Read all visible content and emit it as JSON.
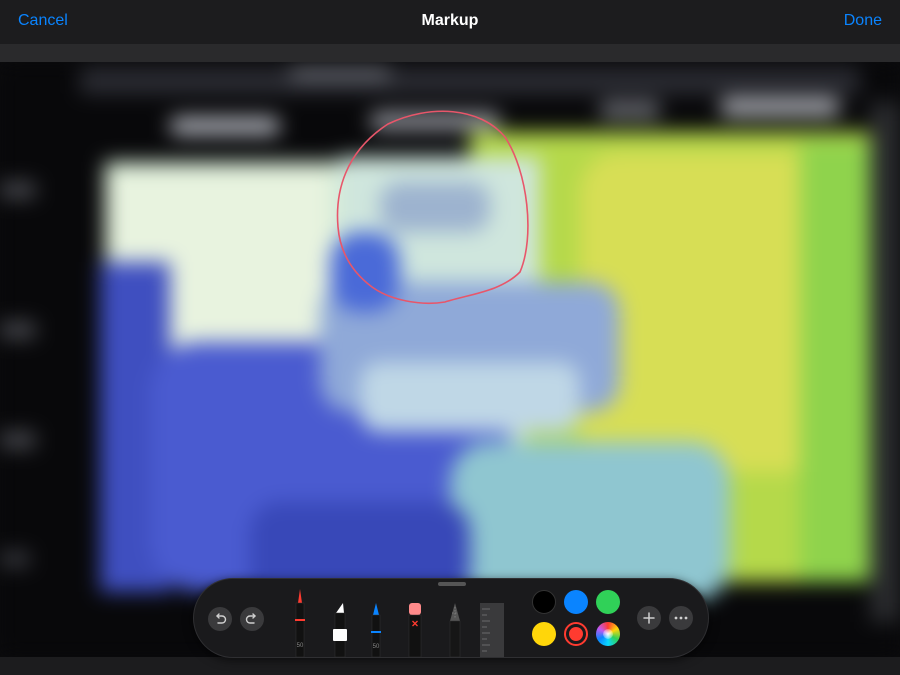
{
  "nav": {
    "cancel_label": "Cancel",
    "title": "Markup",
    "done_label": "Done"
  },
  "palette": {
    "tools": [
      {
        "name": "pen",
        "label": "50",
        "color": "#ff3b30"
      },
      {
        "name": "marker",
        "label": "",
        "color": "#ffffff"
      },
      {
        "name": "pencil",
        "label": "50",
        "color": "#0a84ff"
      },
      {
        "name": "eraser",
        "label": "",
        "color": "#ff8a8a"
      },
      {
        "name": "lasso",
        "label": "",
        "color": "#9a9a9a"
      },
      {
        "name": "ruler",
        "label": "",
        "color": "#4a4a4a"
      }
    ],
    "colors": [
      "#000000",
      "#0a84ff",
      "#30d158",
      "#ffd60a",
      "#ff3b30",
      "color-wheel"
    ],
    "selected_color": "#ff3b30",
    "icons": [
      "undo-icon",
      "redo-icon",
      "add-icon",
      "more-icon"
    ]
  }
}
